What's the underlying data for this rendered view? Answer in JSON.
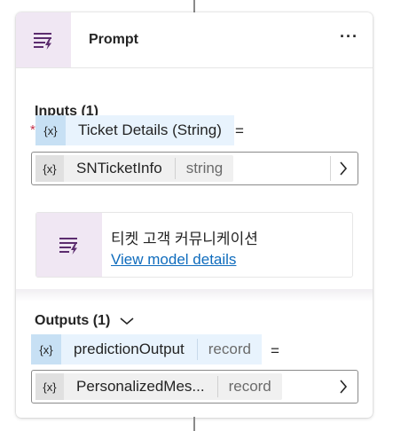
{
  "node": {
    "title": "Prompt",
    "more_label": "···",
    "icon": "prompt-icon"
  },
  "inputs": {
    "label": "Inputs (1)",
    "required_mark": "*",
    "parameter": {
      "var_icon": "{x}",
      "name": "Ticket Details (String)",
      "equals": "="
    },
    "value": {
      "var_icon": "{x}",
      "name": "SNTicketInfo",
      "type": "string"
    }
  },
  "prompt": {
    "name": "티켓 고객 커뮤니케이션",
    "link": "View model details"
  },
  "outputs": {
    "label": "Outputs (1)",
    "variable": {
      "var_icon": "{x}",
      "name": "predictionOutput",
      "type": "record",
      "equals": "="
    },
    "value": {
      "var_icon": "{x}",
      "name": "PersonalizedMes...",
      "type": "record"
    }
  }
}
